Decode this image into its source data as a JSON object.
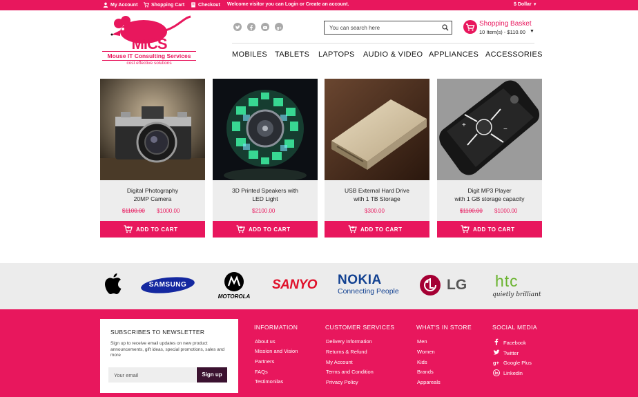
{
  "topbar": {
    "my_account": "My Account",
    "shopping_cart": "Shopping Cart",
    "checkout": "Checkout",
    "welcome": "Welcome visitor you can Login or Create an account.",
    "currency": "$ Dollar"
  },
  "logo": {
    "mark": "MICS",
    "name": "Mouse IT Consulting Services",
    "tagline": "cost effective solutions"
  },
  "social_icons": [
    "twitter-icon",
    "facebook-icon",
    "youtube-icon",
    "google-plus-icon"
  ],
  "search": {
    "placeholder": "You can search here"
  },
  "basket": {
    "title": "Shopping Basket",
    "summary": "10 Item(s) - $110.00"
  },
  "nav": [
    "MOBILES",
    "TABLETS",
    "LAPTOPS",
    "AUDIO & VIDEO",
    "APPLIANCES",
    "ACCESSORIES"
  ],
  "products": [
    {
      "title1": "Digital Photography",
      "title2": "20MP Camera",
      "old_price": "$1100.00",
      "price": "$1000.00"
    },
    {
      "title1": "3D Printed Speakers with",
      "title2": "LED Light",
      "old_price": "",
      "price": "$2100.00"
    },
    {
      "title1": "USB  External Hard Drive",
      "title2": "with 1 TB Storage",
      "old_price": "",
      "price": "$300.00"
    },
    {
      "title1": "Digit MP3 Player",
      "title2": "with 1 GB storage capacity",
      "old_price": "$1100.00",
      "price": "$1000.00"
    }
  ],
  "add_to_cart": "ADD TO CART",
  "brands": {
    "apple": "apple-logo",
    "samsung": "SAMSUNG",
    "motorola": "MOTOROLA",
    "sanyo": "SANYO",
    "nokia": "NOKIA",
    "nokia_tag": "Connecting People",
    "lg": "LG",
    "htc": "htc",
    "htc_tag": "quietly brilliant"
  },
  "newsletter": {
    "title": "SUBSCRIBES TO NEWSLETTER",
    "text": "Sign up to receive email updates on new product announcements, gift ideas, special promotions, sales and more",
    "placeholder": "Your email",
    "button": "Sign up"
  },
  "footer": {
    "information": {
      "heading": "INFORMATION",
      "links": [
        "About us",
        "Mission and Vision",
        "Partners",
        "FAQs",
        "Testimonilas"
      ]
    },
    "customer": {
      "heading": "CUSTOMER SERVICES",
      "links": [
        "Delivery Information",
        "Returns & Refund",
        "My Account",
        "Terms and Condition",
        "Privacy Policy"
      ]
    },
    "store": {
      "heading": "WHAT'S IN STORE",
      "links": [
        "Men",
        "Women",
        "Kids",
        "Brands",
        "Appareals"
      ]
    },
    "social": {
      "heading": "SOCIAL MEDIA",
      "links": [
        "Facebook",
        "Twitter",
        "Google Plus",
        "Linkedin"
      ]
    }
  },
  "colors": {
    "accent": "#e8175d",
    "button_dark": "#3b1230",
    "brand_bar": "#ececec"
  }
}
